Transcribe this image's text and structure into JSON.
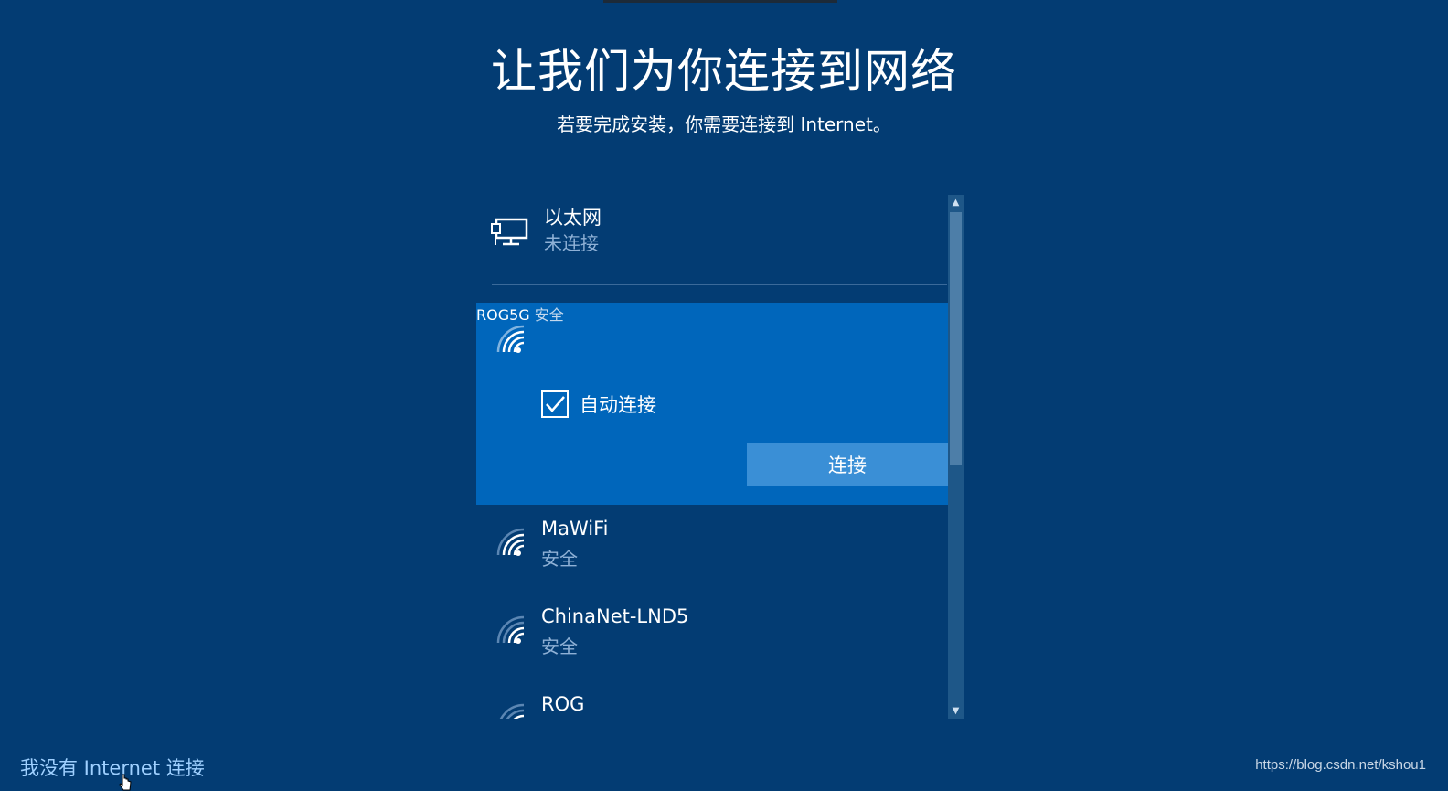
{
  "header": {
    "title": "让我们为你连接到网络",
    "subtitle": "若要完成安装，你需要连接到 Internet。"
  },
  "networks": {
    "ethernet": {
      "name": "以太网",
      "status": "未连接",
      "icon": "ethernet-icon"
    },
    "selected": {
      "name": "ROG5G",
      "status": "安全",
      "icon": "wifi-icon",
      "auto_connect_label": "自动连接",
      "auto_connect_checked": true,
      "connect_label": "连接"
    },
    "items": [
      {
        "name": "MaWiFi",
        "status": "安全",
        "icon": "wifi-icon"
      },
      {
        "name": "ChinaNet-LND5",
        "status": "安全",
        "icon": "wifi-icon"
      },
      {
        "name": "ROG",
        "status": "",
        "icon": "wifi-icon"
      }
    ]
  },
  "footer": {
    "no_internet_link": "我没有 Internet 连接",
    "watermark": "https://blog.csdn.net/kshou1"
  },
  "colors": {
    "background": "#033c73",
    "selected": "#0066bb",
    "button": "#3a8fd6",
    "link": "#9fd0ff"
  }
}
